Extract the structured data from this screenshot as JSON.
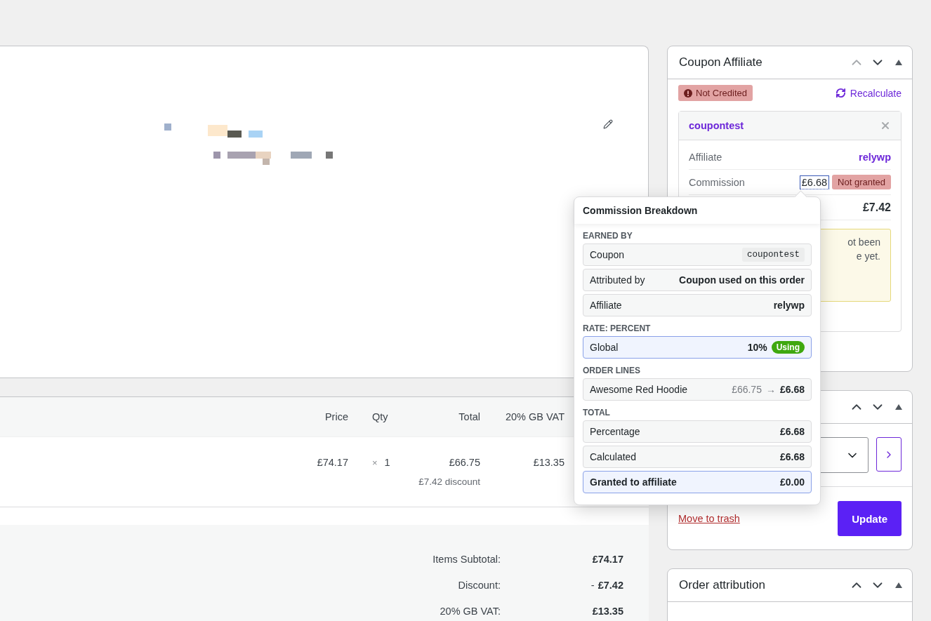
{
  "items_table": {
    "columns": [
      "Price",
      "Qty",
      "Total",
      "20% GB VAT"
    ],
    "rows": [
      {
        "price": "£74.17",
        "qty_sign": "×",
        "qty": "1",
        "total": "£66.75",
        "discount": "£7.42 discount",
        "vat": "£13.35"
      }
    ]
  },
  "totals": [
    {
      "label": "Items Subtotal:",
      "value": "£74.17"
    },
    {
      "label": "Discount:",
      "prefix": "-",
      "value": "£7.42"
    },
    {
      "label": "20% GB VAT:",
      "value": "£13.35"
    }
  ],
  "coupon_affiliate": {
    "title": "Coupon Affiliate",
    "up_disabled": true,
    "status": "Not Credited",
    "recalculate": "Recalculate",
    "coupon": {
      "code": "coupontest",
      "rows": [
        {
          "kind": "link",
          "label": "Affiliate",
          "value": "relywp"
        },
        {
          "kind": "commission",
          "label": "Commission",
          "value": "£6.68",
          "badge": "Not granted"
        },
        {
          "kind": "amount",
          "value": "£7.42"
        }
      ],
      "notice": [
        "ot been",
        "e yet."
      ]
    }
  },
  "breakdown": {
    "title": "Commission Breakdown",
    "sections": [
      {
        "heading": "EARNED BY",
        "rows": [
          {
            "kind": "code",
            "label": "Coupon",
            "value": "coupontest",
            "highlighted": false
          },
          {
            "kind": "text",
            "label": "Attributed by",
            "value": "Coupon used on this order",
            "highlighted": false
          },
          {
            "kind": "text",
            "label": "Affiliate",
            "value": "relywp",
            "highlighted": false
          }
        ]
      },
      {
        "heading": "RATE: PERCENT",
        "rows": [
          {
            "kind": "rate",
            "label": "Global",
            "value": "10%",
            "badge": "Using",
            "highlighted": true
          }
        ]
      },
      {
        "heading": "ORDER LINES",
        "rows": [
          {
            "kind": "line",
            "label": "Awesome Red Hoodie",
            "from": "£66.75",
            "arrow": "→",
            "value": "£6.68",
            "highlighted": false
          }
        ]
      },
      {
        "heading": "TOTAL",
        "rows": [
          {
            "kind": "text",
            "label": "Percentage",
            "value": "£6.68",
            "highlighted": false
          },
          {
            "kind": "text",
            "label": "Calculated",
            "value": "£6.68",
            "highlighted": false
          },
          {
            "kind": "granted",
            "label": "Granted to affiliate",
            "value": "£0.00",
            "highlighted": true
          }
        ]
      }
    ]
  },
  "order_actions": {
    "up_disabled": false,
    "trash_link": "Move to trash",
    "update_button": "Update"
  },
  "order_attribution": {
    "title": "Order attribution",
    "up_disabled": false
  }
}
